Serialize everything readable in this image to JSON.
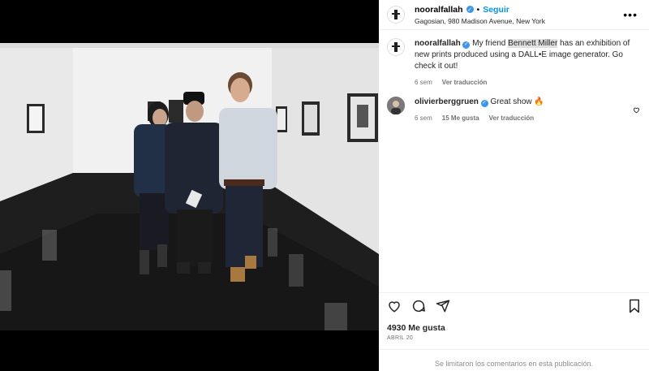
{
  "post": {
    "author": "nooralfallah",
    "follow_label": "Seguir",
    "separator": "•",
    "location": "Gagosian, 980 Madison Avenue, New York"
  },
  "caption": {
    "author": "nooralfallah",
    "text_before": "My friend ",
    "highlight": "Bennett Miller",
    "text_after": " has an exhibition of new prints produced using a DALL•E image generator. Go check it out!",
    "time": "6 sem",
    "translate_label": "Ver traducción"
  },
  "comment": {
    "author": "olivierberggruen",
    "text": "Great show 🔥",
    "time": "6 sem",
    "likes": "15 Me gusta",
    "translate_label": "Ver traducción"
  },
  "stats": {
    "likes": "4930 Me gusta",
    "date": "ABRIL 20"
  },
  "footer": {
    "comments_closed": "Se limitaron los comentarios en esta publicación."
  },
  "colors": {
    "accent": "#0095f6",
    "verified": "#3897f0"
  }
}
